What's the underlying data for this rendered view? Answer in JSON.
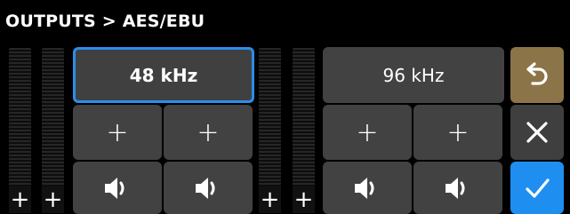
{
  "header": {
    "title": "OUTPUTS > AES/EBU"
  },
  "left_group": {
    "rate_label": "48 kHz",
    "selected": true
  },
  "right_group": {
    "rate_label": "96 kHz",
    "selected": false
  },
  "add_glyph": "+",
  "strip_add_glyph": "+",
  "icons": {
    "speaker": "speaker-icon",
    "undo": "undo-icon",
    "close": "close-icon",
    "confirm": "check-icon"
  },
  "colors": {
    "selected_border": "#2a8eea",
    "undo_button": "#8b7548",
    "confirm_button": "#1e8ff0",
    "button": "#424242",
    "background": "#000000"
  }
}
